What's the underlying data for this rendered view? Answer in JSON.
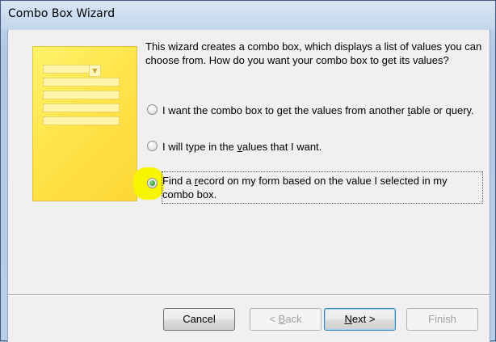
{
  "window": {
    "title": "Combo Box Wizard"
  },
  "intro_text": "This wizard creates a combo box, which displays a list of values you can choose from.  How do you want your combo box to get its values?",
  "options": [
    {
      "pre": "I want the combo box to get the values from another ",
      "key": "t",
      "post": "able or query.",
      "selected": false
    },
    {
      "pre": "I will type in the ",
      "key": "v",
      "post": "alues that I want.",
      "selected": false
    },
    {
      "pre": "Find a ",
      "key": "r",
      "post": "ecord on my form based on the value I selected in my",
      "line2": "combo box.",
      "selected": true
    }
  ],
  "buttons": {
    "cancel": {
      "label": "Cancel"
    },
    "back": {
      "pre": "< ",
      "key": "B",
      "post": "ack",
      "enabled": false
    },
    "next": {
      "pre": "",
      "key": "N",
      "post": "ext >",
      "enabled": true
    },
    "finish": {
      "label": "Finish",
      "enabled": false
    }
  },
  "colors": {
    "highlight": "#f8f500",
    "illustration": "#ffe44a"
  }
}
